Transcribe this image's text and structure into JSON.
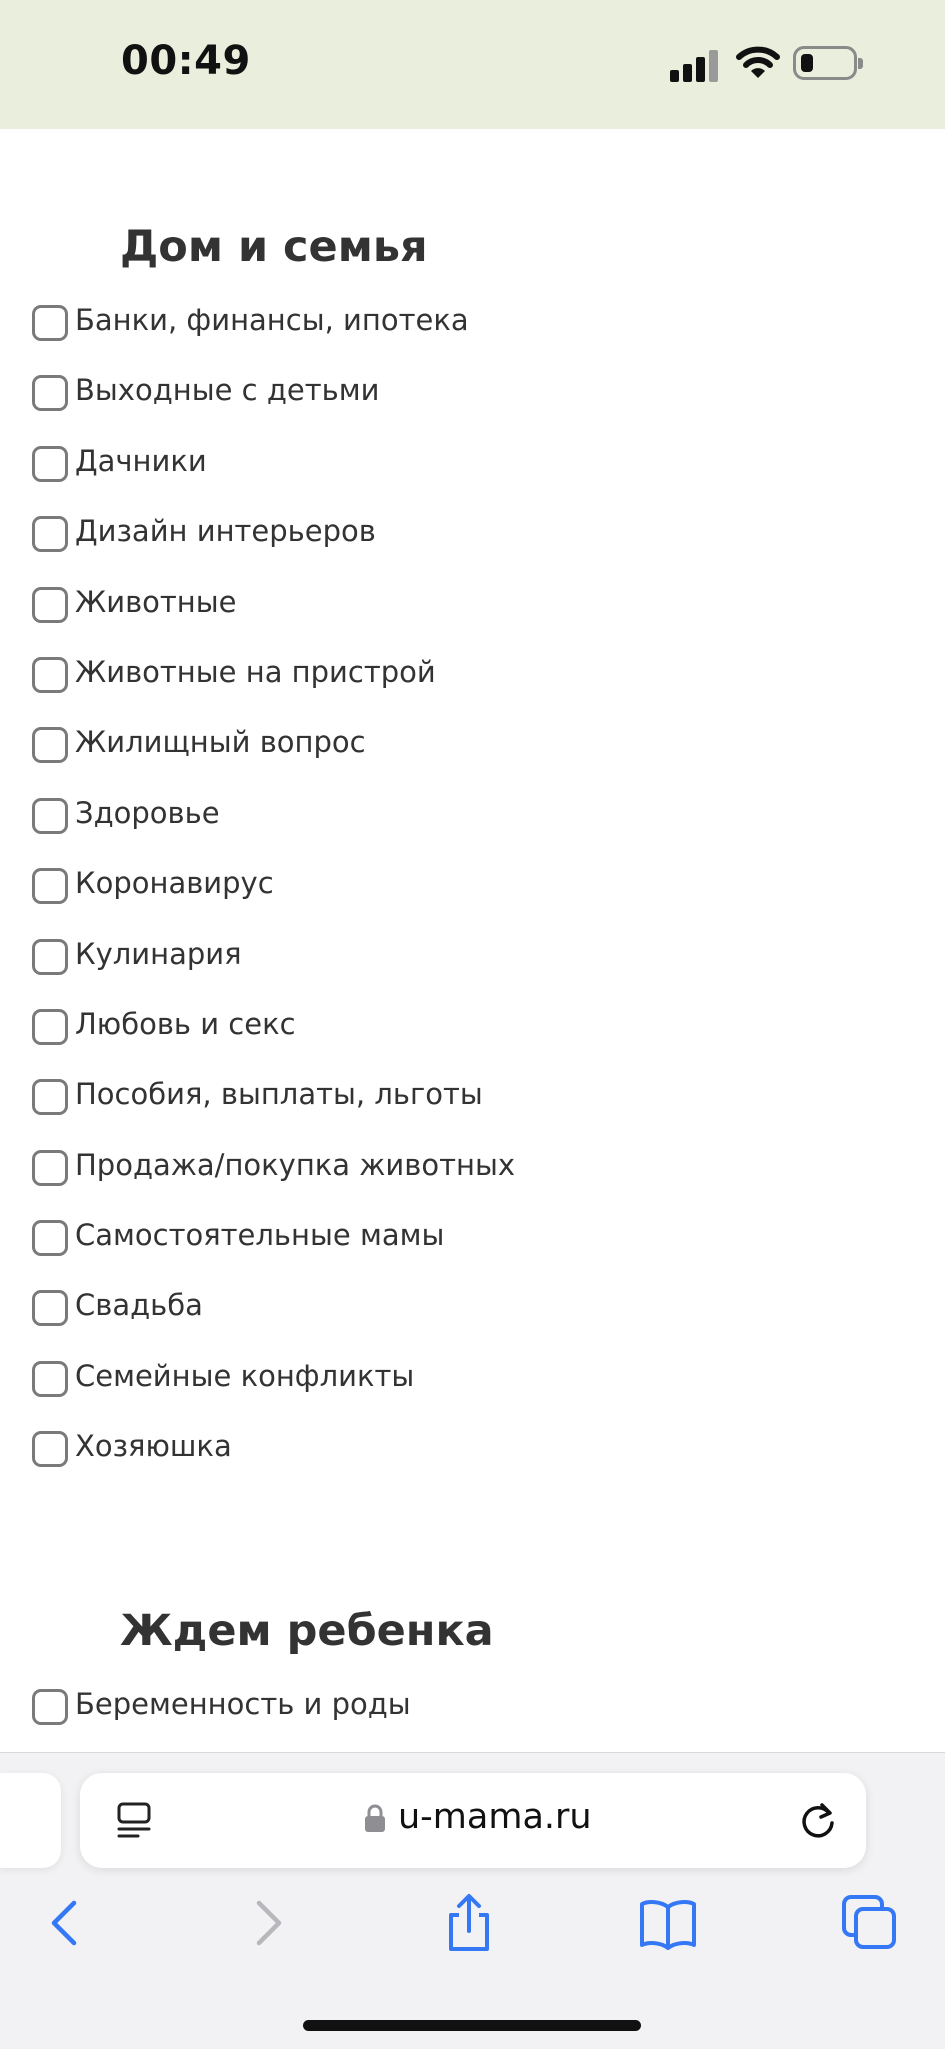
{
  "status_bar": {
    "time": "00:49"
  },
  "sections": [
    {
      "title": "Дом и семья",
      "items": [
        "Банки, финансы, ипотека",
        "Выходные с детьми",
        "Дачники",
        "Дизайн интерьеров",
        "Животные",
        "Животные на пристрой",
        "Жилищный вопрос",
        "Здоровье",
        "Коронавирус",
        "Кулинария",
        "Любовь и секс",
        "Пособия, выплаты, льготы",
        "Продажа/покупка животных",
        "Самостоятельные мамы",
        "Свадьба",
        "Семейные конфликты",
        "Хозяюшка"
      ]
    },
    {
      "title": "Ждем ребенка",
      "items": [
        "Беременность и роды"
      ]
    }
  ],
  "browser": {
    "url": "u-mama.ru"
  },
  "colors": {
    "status_bar_bg": "#e9efdc",
    "accent_blue": "#3478f6",
    "disabled_gray": "#b8b8bc"
  }
}
